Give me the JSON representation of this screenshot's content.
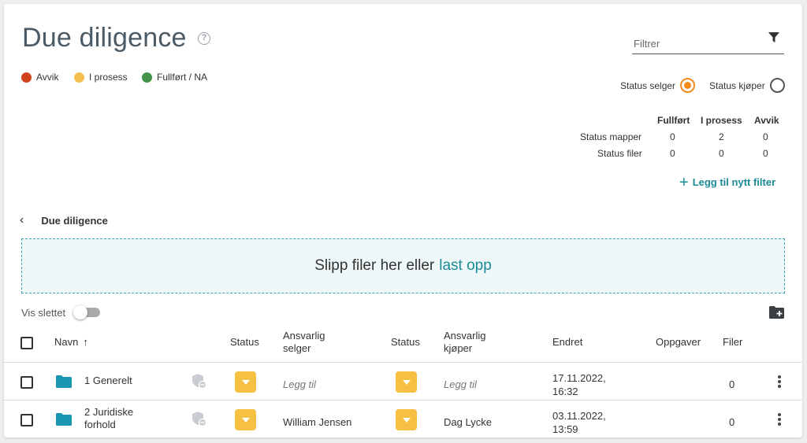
{
  "page": {
    "title": "Due diligence",
    "help_icon": "help-circle-icon"
  },
  "legend": [
    {
      "label": "Avvik",
      "color": "#d0421b"
    },
    {
      "label": "I prosess",
      "color": "#f4bf4f"
    },
    {
      "label": "Fullført / NA",
      "color": "#43944a"
    }
  ],
  "filter": {
    "placeholder": "Filtrer",
    "icon": "funnel-icon"
  },
  "status_toggle": {
    "seller_label": "Status selger",
    "buyer_label": "Status kjøper",
    "selected": "seller",
    "accent": "#f28a1c"
  },
  "status_table": {
    "headers": [
      "Fullført",
      "I prosess",
      "Avvik"
    ],
    "rows": [
      {
        "label": "Status mapper",
        "values": [
          "0",
          "2",
          "0"
        ]
      },
      {
        "label": "Status filer",
        "values": [
          "0",
          "0",
          "0"
        ]
      }
    ]
  },
  "add_filter": {
    "label": "Legg til nytt filter",
    "icon": "plus-icon"
  },
  "breadcrumb": {
    "label": "Due diligence",
    "icon": "chevron-left-icon"
  },
  "dropzone": {
    "text": "Slipp filer her eller",
    "link": "last opp"
  },
  "show_deleted": {
    "label": "Vis slettet",
    "on": false
  },
  "new_folder_icon": "folder-plus-icon",
  "table": {
    "headers": {
      "name": "Navn",
      "status_seller": "Status",
      "responsible_seller_1": "Ansvarlig",
      "responsible_seller_2": "selger",
      "status_buyer": "Status",
      "responsible_buyer_1": "Ansvarlig",
      "responsible_buyer_2": "kjøper",
      "changed": "Endret",
      "tasks": "Oppgaver",
      "files": "Filer"
    },
    "rows": [
      {
        "name_1": "1 Generelt",
        "name_2": "",
        "responsible_seller": "Legg til",
        "responsible_buyer": "Legg til",
        "changed_1": "17.11.2022,",
        "changed_2": "16:32",
        "tasks": "",
        "files": "0"
      },
      {
        "name_1": "2 Juridiske",
        "name_2": "forhold",
        "responsible_seller": "William Jensen",
        "responsible_buyer": "Dag Lycke",
        "changed_1": "03.11.2022,",
        "changed_2": "13:59",
        "tasks": "",
        "files": "0"
      }
    ]
  },
  "colors": {
    "teal": "#1a8a96",
    "status_button": "#f6c142",
    "folder": "#1a97b0"
  }
}
